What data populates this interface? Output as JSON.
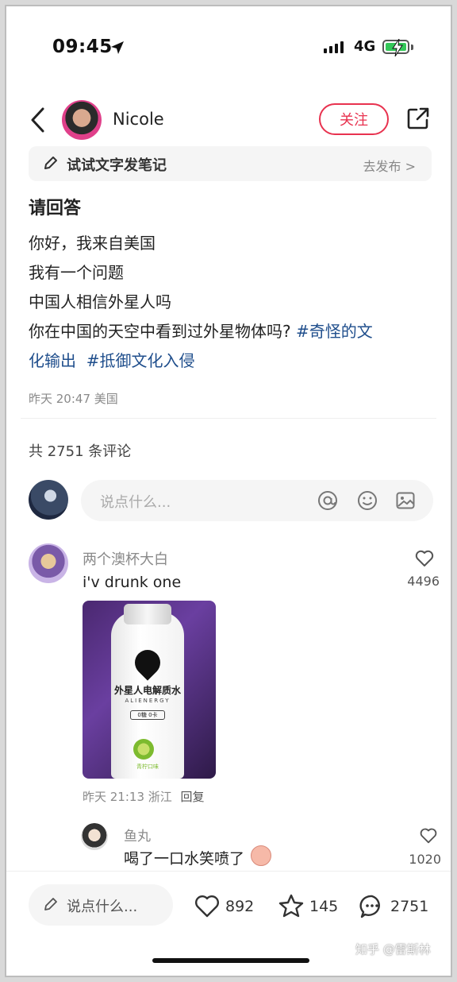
{
  "status_bar": {
    "time": "09:45",
    "network": "4G"
  },
  "header": {
    "username": "Nicole",
    "follow_label": "关注"
  },
  "tip_bar": {
    "text": "试试文字发笔记",
    "action": "去发布 >"
  },
  "post": {
    "title": "请回答",
    "lines": [
      "你好，我来自美国",
      "我有一个问题",
      "中国人相信外星人吗",
      "你在中国的天空中看到过外星物体吗?"
    ],
    "tags": [
      "#奇怪的文",
      "化输出",
      "#抵御文化入侵"
    ],
    "meta": "昨天 20:47 美国"
  },
  "comments_header": {
    "count_text": "共 2751 条评论"
  },
  "comment_input": {
    "placeholder": "说点什么..."
  },
  "comment": {
    "username": "两个澳杯大白",
    "text": "i'v drunk one",
    "likes": "4496",
    "meta": "昨天 21:13 浙江",
    "reply_label": "回复",
    "photo": {
      "brand": "外星人电解质水",
      "brand_sub": "ALIENERGY",
      "badge": "0糖 0卡",
      "flavor": "青柠口味"
    }
  },
  "reply": {
    "username": "鱼丸",
    "text": "喝了一口水笑喷了",
    "likes": "1020"
  },
  "bottom_bar": {
    "input_placeholder": "说点什么...",
    "likes": "892",
    "favorites": "145",
    "comments": "2751"
  },
  "watermark": "知乎 @雷斯林",
  "colors": {
    "accent": "#e8324f",
    "tag": "#1f4e8c"
  }
}
